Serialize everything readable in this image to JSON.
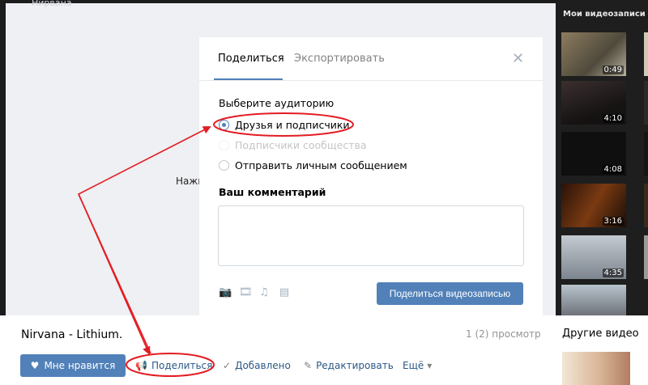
{
  "page": {
    "player_top_text": "Нирвана",
    "player_hint": "Нажм",
    "video_title": "Nirvana - Lithium.",
    "views": "1 (2) просмотр",
    "actions": {
      "like": "Мне нравится",
      "share": "Поделиться",
      "added": "Добавлено",
      "edit": "Редактировать",
      "more": "Ещё"
    }
  },
  "sidebar": {
    "title": "Мои видеозаписи",
    "videos": [
      {
        "duration": "0:49",
        "color": "#7a6a55"
      },
      {
        "duration": "4:10",
        "color": "#2a2424"
      },
      {
        "duration": "4:08",
        "color": "#121212"
      },
      {
        "duration": "3:16",
        "color": "#4a2a12"
      },
      {
        "duration": "4:35",
        "color": "#9aa3ad"
      }
    ],
    "other_title": "Другие видео"
  },
  "modal": {
    "tabs": {
      "share": "Поделиться",
      "export": "Экспортировать"
    },
    "audience_label": "Выберите аудиторию",
    "options": {
      "friends": "Друзья и подписчики",
      "community": "Подписчики сообщества",
      "message": "Отправить личным сообщением"
    },
    "comment_label": "Ваш комментарий",
    "comment_value": "",
    "submit": "Поделиться видеозаписью"
  },
  "icons": {
    "close": "close-icon",
    "photo": "camera-icon",
    "video": "film-icon",
    "music": "music-note-icon",
    "doc": "document-icon"
  },
  "colors": {
    "accent": "#5181b8",
    "annotation": "#e31c23"
  }
}
